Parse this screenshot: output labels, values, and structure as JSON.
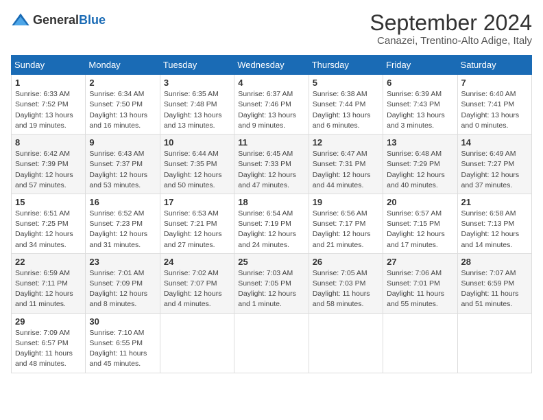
{
  "header": {
    "logo_general": "General",
    "logo_blue": "Blue",
    "title": "September 2024",
    "subtitle": "Canazei, Trentino-Alto Adige, Italy"
  },
  "calendar": {
    "headers": [
      "Sunday",
      "Monday",
      "Tuesday",
      "Wednesday",
      "Thursday",
      "Friday",
      "Saturday"
    ],
    "weeks": [
      [
        {
          "day": "1",
          "sunrise": "6:33 AM",
          "sunset": "7:52 PM",
          "daylight": "13 hours and 19 minutes."
        },
        {
          "day": "2",
          "sunrise": "6:34 AM",
          "sunset": "7:50 PM",
          "daylight": "13 hours and 16 minutes."
        },
        {
          "day": "3",
          "sunrise": "6:35 AM",
          "sunset": "7:48 PM",
          "daylight": "13 hours and 13 minutes."
        },
        {
          "day": "4",
          "sunrise": "6:37 AM",
          "sunset": "7:46 PM",
          "daylight": "13 hours and 9 minutes."
        },
        {
          "day": "5",
          "sunrise": "6:38 AM",
          "sunset": "7:44 PM",
          "daylight": "13 hours and 6 minutes."
        },
        {
          "day": "6",
          "sunrise": "6:39 AM",
          "sunset": "7:43 PM",
          "daylight": "13 hours and 3 minutes."
        },
        {
          "day": "7",
          "sunrise": "6:40 AM",
          "sunset": "7:41 PM",
          "daylight": "13 hours and 0 minutes."
        }
      ],
      [
        {
          "day": "8",
          "sunrise": "6:42 AM",
          "sunset": "7:39 PM",
          "daylight": "12 hours and 57 minutes."
        },
        {
          "day": "9",
          "sunrise": "6:43 AM",
          "sunset": "7:37 PM",
          "daylight": "12 hours and 53 minutes."
        },
        {
          "day": "10",
          "sunrise": "6:44 AM",
          "sunset": "7:35 PM",
          "daylight": "12 hours and 50 minutes."
        },
        {
          "day": "11",
          "sunrise": "6:45 AM",
          "sunset": "7:33 PM",
          "daylight": "12 hours and 47 minutes."
        },
        {
          "day": "12",
          "sunrise": "6:47 AM",
          "sunset": "7:31 PM",
          "daylight": "12 hours and 44 minutes."
        },
        {
          "day": "13",
          "sunrise": "6:48 AM",
          "sunset": "7:29 PM",
          "daylight": "12 hours and 40 minutes."
        },
        {
          "day": "14",
          "sunrise": "6:49 AM",
          "sunset": "7:27 PM",
          "daylight": "12 hours and 37 minutes."
        }
      ],
      [
        {
          "day": "15",
          "sunrise": "6:51 AM",
          "sunset": "7:25 PM",
          "daylight": "12 hours and 34 minutes."
        },
        {
          "day": "16",
          "sunrise": "6:52 AM",
          "sunset": "7:23 PM",
          "daylight": "12 hours and 31 minutes."
        },
        {
          "day": "17",
          "sunrise": "6:53 AM",
          "sunset": "7:21 PM",
          "daylight": "12 hours and 27 minutes."
        },
        {
          "day": "18",
          "sunrise": "6:54 AM",
          "sunset": "7:19 PM",
          "daylight": "12 hours and 24 minutes."
        },
        {
          "day": "19",
          "sunrise": "6:56 AM",
          "sunset": "7:17 PM",
          "daylight": "12 hours and 21 minutes."
        },
        {
          "day": "20",
          "sunrise": "6:57 AM",
          "sunset": "7:15 PM",
          "daylight": "12 hours and 17 minutes."
        },
        {
          "day": "21",
          "sunrise": "6:58 AM",
          "sunset": "7:13 PM",
          "daylight": "12 hours and 14 minutes."
        }
      ],
      [
        {
          "day": "22",
          "sunrise": "6:59 AM",
          "sunset": "7:11 PM",
          "daylight": "12 hours and 11 minutes."
        },
        {
          "day": "23",
          "sunrise": "7:01 AM",
          "sunset": "7:09 PM",
          "daylight": "12 hours and 8 minutes."
        },
        {
          "day": "24",
          "sunrise": "7:02 AM",
          "sunset": "7:07 PM",
          "daylight": "12 hours and 4 minutes."
        },
        {
          "day": "25",
          "sunrise": "7:03 AM",
          "sunset": "7:05 PM",
          "daylight": "12 hours and 1 minute."
        },
        {
          "day": "26",
          "sunrise": "7:05 AM",
          "sunset": "7:03 PM",
          "daylight": "11 hours and 58 minutes."
        },
        {
          "day": "27",
          "sunrise": "7:06 AM",
          "sunset": "7:01 PM",
          "daylight": "11 hours and 55 minutes."
        },
        {
          "day": "28",
          "sunrise": "7:07 AM",
          "sunset": "6:59 PM",
          "daylight": "11 hours and 51 minutes."
        }
      ],
      [
        {
          "day": "29",
          "sunrise": "7:09 AM",
          "sunset": "6:57 PM",
          "daylight": "11 hours and 48 minutes."
        },
        {
          "day": "30",
          "sunrise": "7:10 AM",
          "sunset": "6:55 PM",
          "daylight": "11 hours and 45 minutes."
        },
        null,
        null,
        null,
        null,
        null
      ]
    ]
  }
}
